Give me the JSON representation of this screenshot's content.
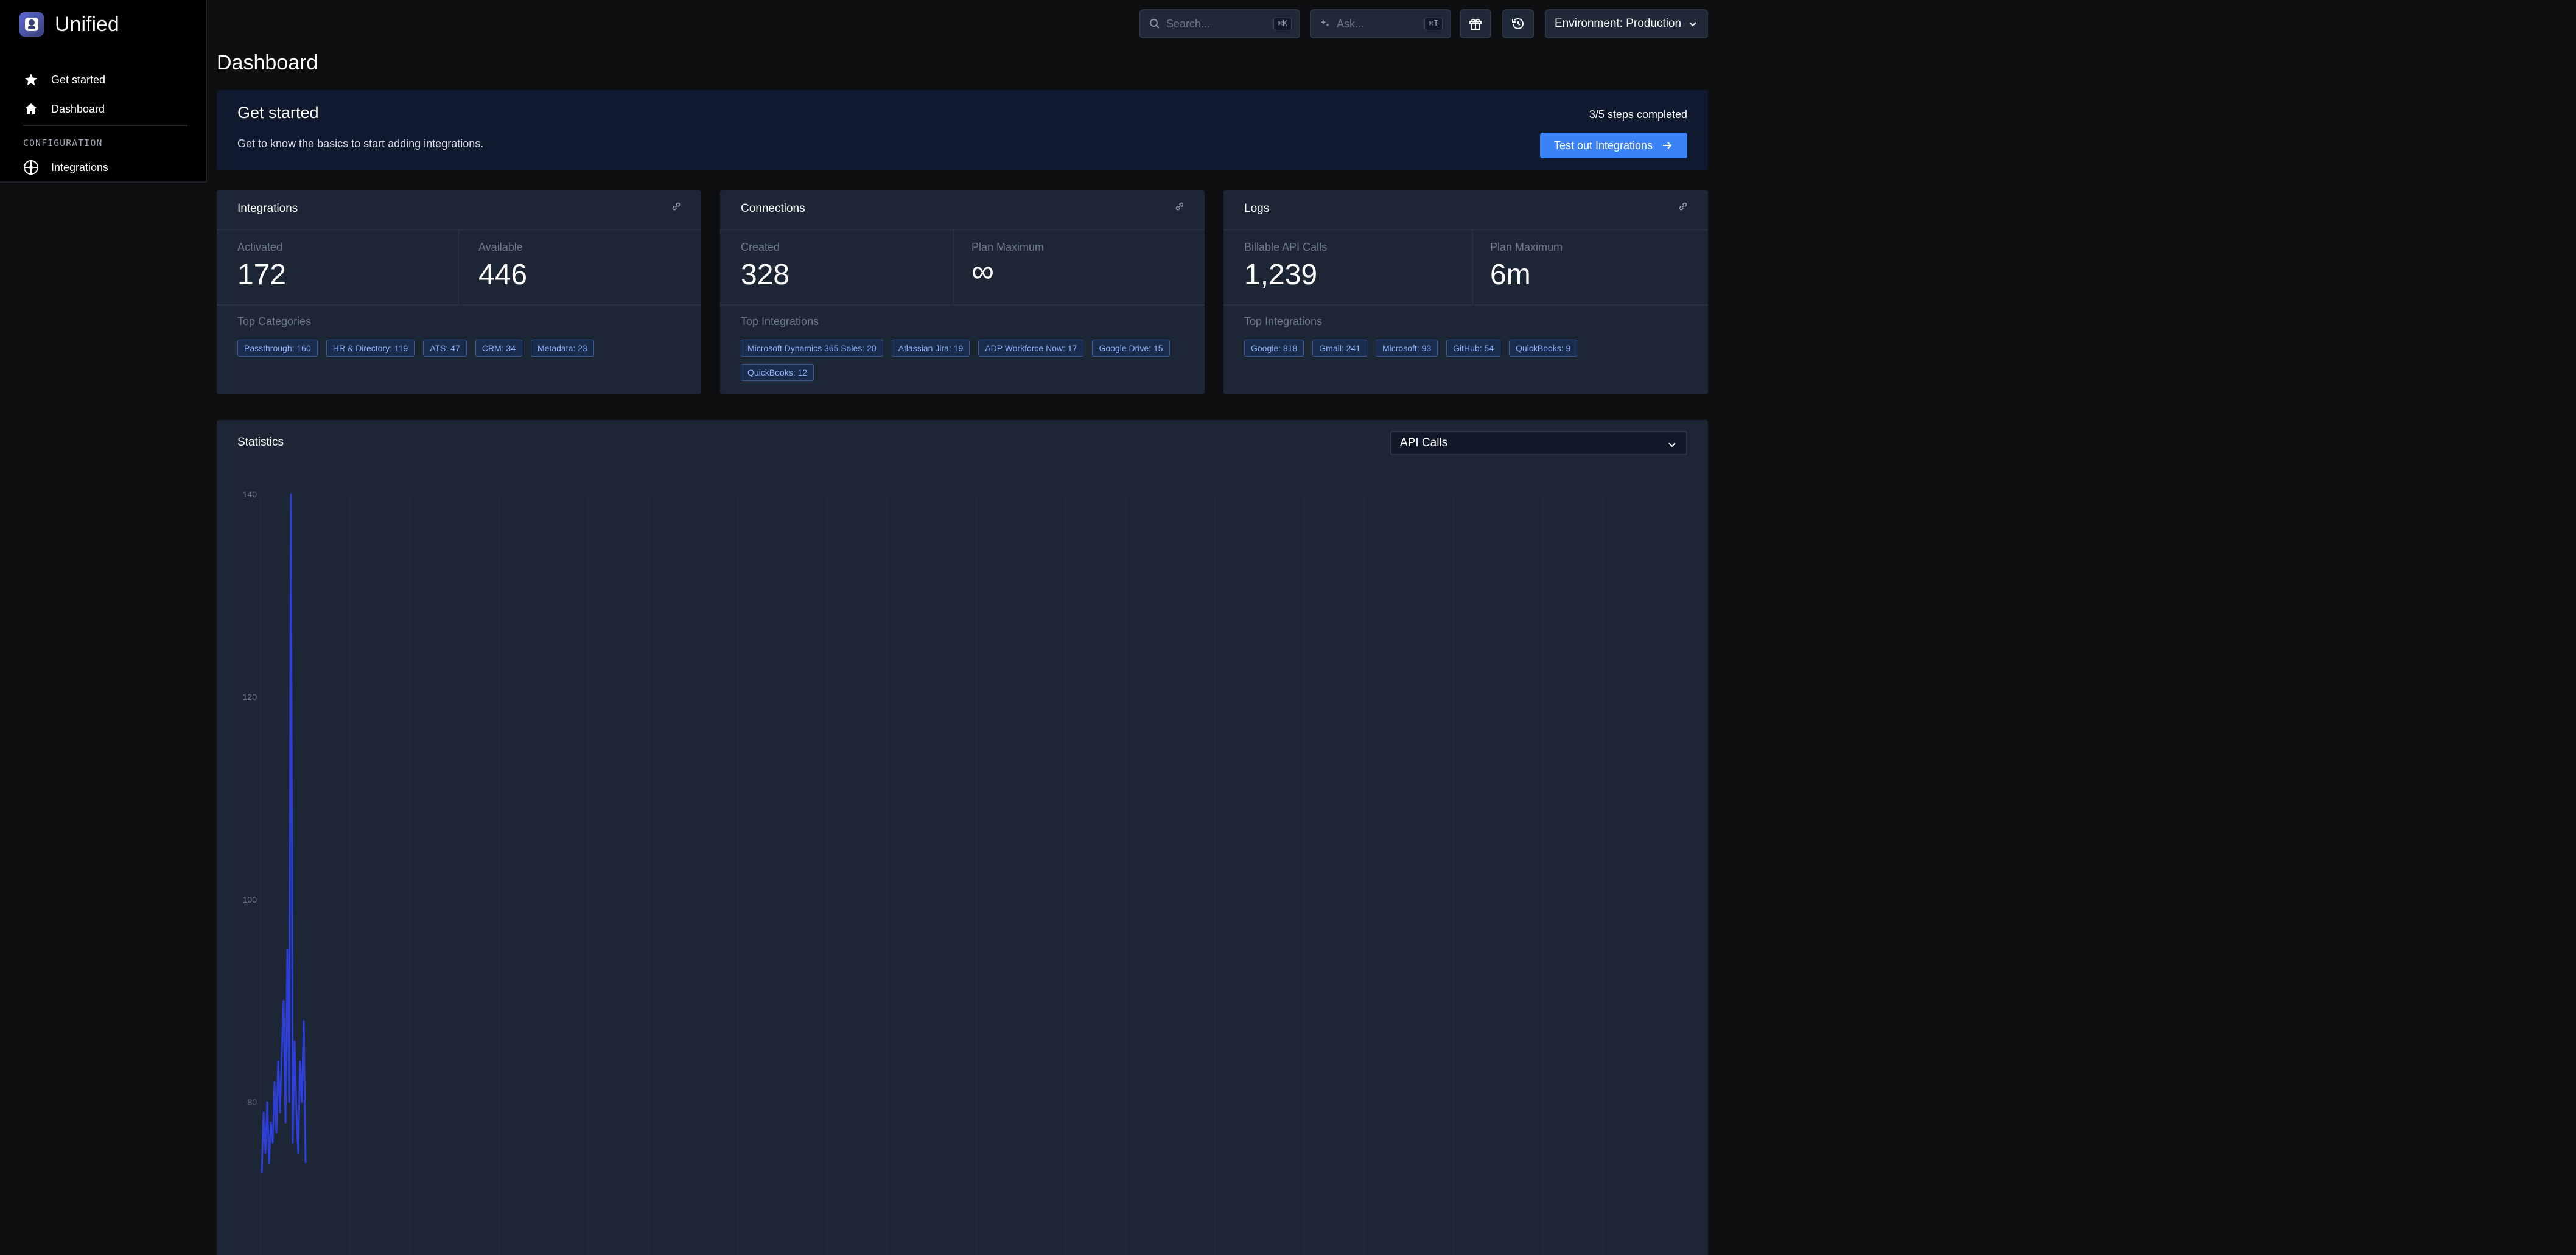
{
  "app": {
    "name": "Unified"
  },
  "sidebar": {
    "items": [
      {
        "label": "Get started",
        "icon": "star-icon"
      },
      {
        "label": "Dashboard",
        "icon": "home-icon"
      }
    ],
    "section_label": "CONFIGURATION",
    "config_items": [
      {
        "label": "Integrations",
        "icon": "integrations-icon"
      }
    ]
  },
  "topbar": {
    "search_placeholder": "Search...",
    "search_shortcut": "⌘K",
    "ask_placeholder": "Ask...",
    "ask_shortcut": "⌘I",
    "environment": "Environment: Production"
  },
  "page": {
    "title": "Dashboard"
  },
  "banner": {
    "title": "Get started",
    "description": "Get to know the basics to start adding integrations.",
    "steps": "3/5 steps completed",
    "cta": "Test out Integrations"
  },
  "cards": {
    "integrations": {
      "title": "Integrations",
      "left_label": "Activated",
      "left_value": "172",
      "right_label": "Available",
      "right_value": "446",
      "tags_label": "Top Categories",
      "tags": [
        "Passthrough: 160",
        "HR & Directory: 119",
        "ATS: 47",
        "CRM: 34",
        "Metadata: 23"
      ]
    },
    "connections": {
      "title": "Connections",
      "left_label": "Created",
      "left_value": "328",
      "right_label": "Plan Maximum",
      "right_value": "∞",
      "tags_label": "Top Integrations",
      "tags": [
        "Microsoft Dynamics 365 Sales: 20",
        "Atlassian Jira: 19",
        "ADP Workforce Now: 17",
        "Google Drive: 15",
        "QuickBooks: 12"
      ]
    },
    "logs": {
      "title": "Logs",
      "left_label": "Billable API Calls",
      "left_value": "1,239",
      "right_label": "Plan Maximum",
      "right_value": "6m",
      "tags_label": "Top Integrations",
      "tags": [
        "Google: 818",
        "Gmail: 241",
        "Microsoft: 93",
        "GitHub: 54",
        "QuickBooks: 9"
      ]
    }
  },
  "statistics": {
    "title": "Statistics",
    "selected_metric": "API Calls"
  },
  "chart_data": {
    "type": "line",
    "y_ticks": [
      140,
      120,
      100,
      80
    ],
    "ylim": [
      70,
      140
    ],
    "series": [
      {
        "color": "#2d3fd6",
        "values": [
          73,
          79,
          75,
          80,
          74,
          78,
          76,
          82,
          77,
          84,
          79,
          85,
          90,
          78,
          95,
          80,
          140,
          76,
          86,
          79,
          75,
          84,
          80,
          88,
          74
        ]
      }
    ]
  },
  "colors": {
    "accent": "#3b82f6",
    "panel": "#1d2635",
    "background": "#0e0f11"
  }
}
